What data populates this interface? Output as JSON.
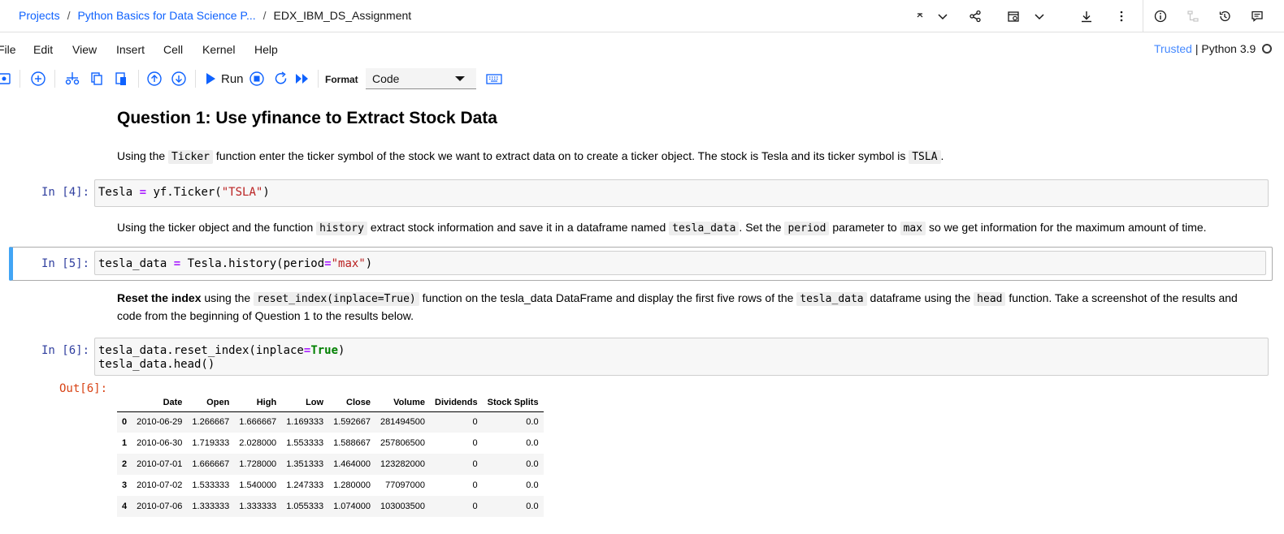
{
  "header": {
    "breadcrumbs": [
      "Projects",
      "Python Basics for Data Science P...",
      "EDX_IBM_DS_Assignment"
    ]
  },
  "menu": [
    "File",
    "Edit",
    "View",
    "Insert",
    "Cell",
    "Kernel",
    "Help"
  ],
  "kernel": {
    "trusted": "Trusted",
    "separator": " | ",
    "name": "Python 3.9"
  },
  "toolbar": {
    "run_label": "Run",
    "format_label": "Format",
    "format_value": "Code"
  },
  "cells": {
    "q1_title": "Question 1: Use yfinance to Extract Stock Data",
    "p1": {
      "t1": "Using the ",
      "c1": "Ticker",
      "t2": " function enter the ticker symbol of the stock we want to extract data on to create a ticker object. The stock is Tesla and its ticker symbol is ",
      "c2": "TSLA",
      "t3": "."
    },
    "cell4": {
      "prompt": "In [4]:",
      "a": "Tesla ",
      "op": "=",
      "b": " yf.Ticker(",
      "s": "\"TSLA\"",
      "c": ")"
    },
    "p2": {
      "t1": "Using the ticker object and the function ",
      "c1": "history",
      "t2": " extract stock information and save it in a dataframe named ",
      "c2": "tesla_data",
      "t3": ". Set the ",
      "c3": "period",
      "t4": " parameter to ",
      "c4": "max",
      "t5": " so we get information for the maximum amount of time."
    },
    "cell5": {
      "prompt": "In [5]:",
      "a": "tesla_data ",
      "op": "=",
      "b": " Tesla.history(period",
      "op2": "=",
      "s": "\"max\"",
      "c": ")"
    },
    "p3": {
      "b1": "Reset the index",
      "t1": " using the ",
      "c1": "reset_index(inplace=True)",
      "t2": " function on the tesla_data DataFrame and display the first five rows of the ",
      "c2": "tesla_data",
      "t3": " dataframe using the ",
      "c3": "head",
      "t4": " function. Take a screenshot of the results and code from the beginning of Question 1 to the results below."
    },
    "cell6": {
      "prompt": "In [6]:",
      "l1a": "tesla_data.reset_index(inplace",
      "op": "=",
      "kw": "True",
      "l1b": ")",
      "l2": "tesla_data.head()",
      "out_prompt": "Out[6]:"
    }
  },
  "table": {
    "columns": [
      "",
      "Date",
      "Open",
      "High",
      "Low",
      "Close",
      "Volume",
      "Dividends",
      "Stock Splits"
    ],
    "rows": [
      [
        "0",
        "2010-06-29",
        "1.266667",
        "1.666667",
        "1.169333",
        "1.592667",
        "281494500",
        "0",
        "0.0"
      ],
      [
        "1",
        "2010-06-30",
        "1.719333",
        "2.028000",
        "1.553333",
        "1.588667",
        "257806500",
        "0",
        "0.0"
      ],
      [
        "2",
        "2010-07-01",
        "1.666667",
        "1.728000",
        "1.351333",
        "1.464000",
        "123282000",
        "0",
        "0.0"
      ],
      [
        "3",
        "2010-07-02",
        "1.533333",
        "1.540000",
        "1.247333",
        "1.280000",
        "77097000",
        "0",
        "0.0"
      ],
      [
        "4",
        "2010-07-06",
        "1.333333",
        "1.333333",
        "1.055333",
        "1.074000",
        "103003500",
        "0",
        "0.0"
      ]
    ]
  },
  "colors": {
    "link": "#0f62fe",
    "prompt_in": "#303f9f",
    "prompt_out": "#d84315",
    "selected_cell": "#42a5f5"
  }
}
